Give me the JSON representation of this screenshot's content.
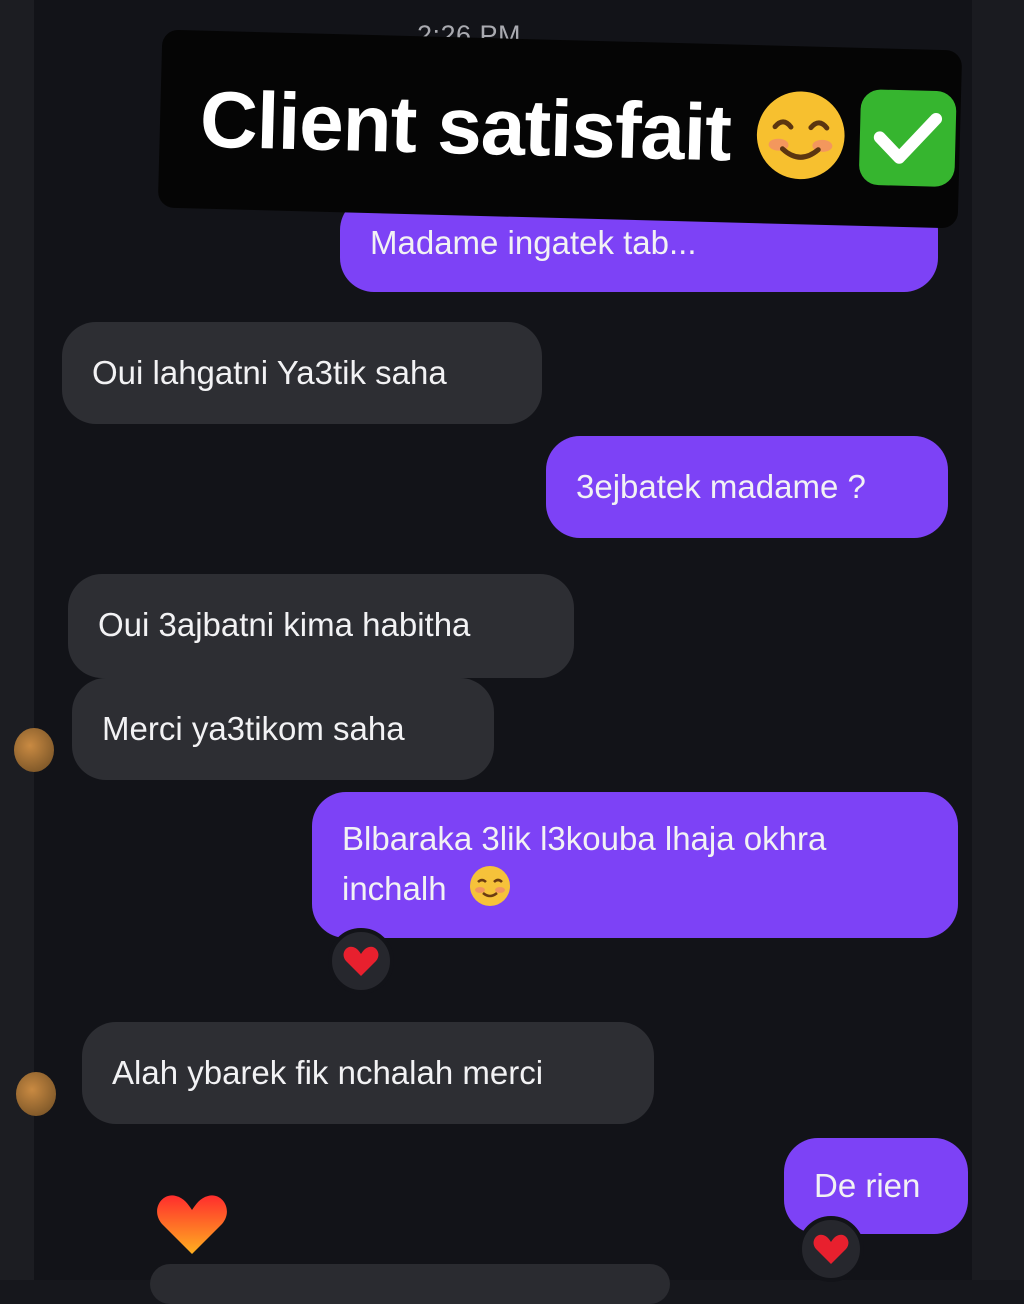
{
  "chat": {
    "timestamp": "2:26 PM",
    "banner": {
      "text": "Client satisfait",
      "emojis": [
        "smiling-face-icon",
        "check-mark-button-icon"
      ]
    },
    "messages": [
      {
        "side": "outgoing",
        "text": "Madame ingatek tab..."
      },
      {
        "side": "incoming",
        "text": "Oui lahgatni Ya3tik saha"
      },
      {
        "side": "outgoing",
        "text": "3ejbatek madame ?"
      },
      {
        "side": "incoming",
        "text": "Oui 3ajbatni kima habitha"
      },
      {
        "side": "incoming",
        "text": "Merci ya3tikom saha"
      },
      {
        "side": "outgoing",
        "line1": "Blbaraka 3lik l3kouba lhaja okhra",
        "line2": "inchalh",
        "reaction": "heart-icon"
      },
      {
        "side": "incoming",
        "text": "Alah ybarek fik nchalah merci"
      },
      {
        "side": "outgoing",
        "text": "De rien",
        "reaction": "heart-icon"
      }
    ]
  },
  "colors": {
    "background": "#121318",
    "incoming_bubble": "#2d2e33",
    "outgoing_bubble": "#7d42f6",
    "text": "#f2f2f4",
    "timestamp": "#a9aab0",
    "banner": "#050505"
  }
}
